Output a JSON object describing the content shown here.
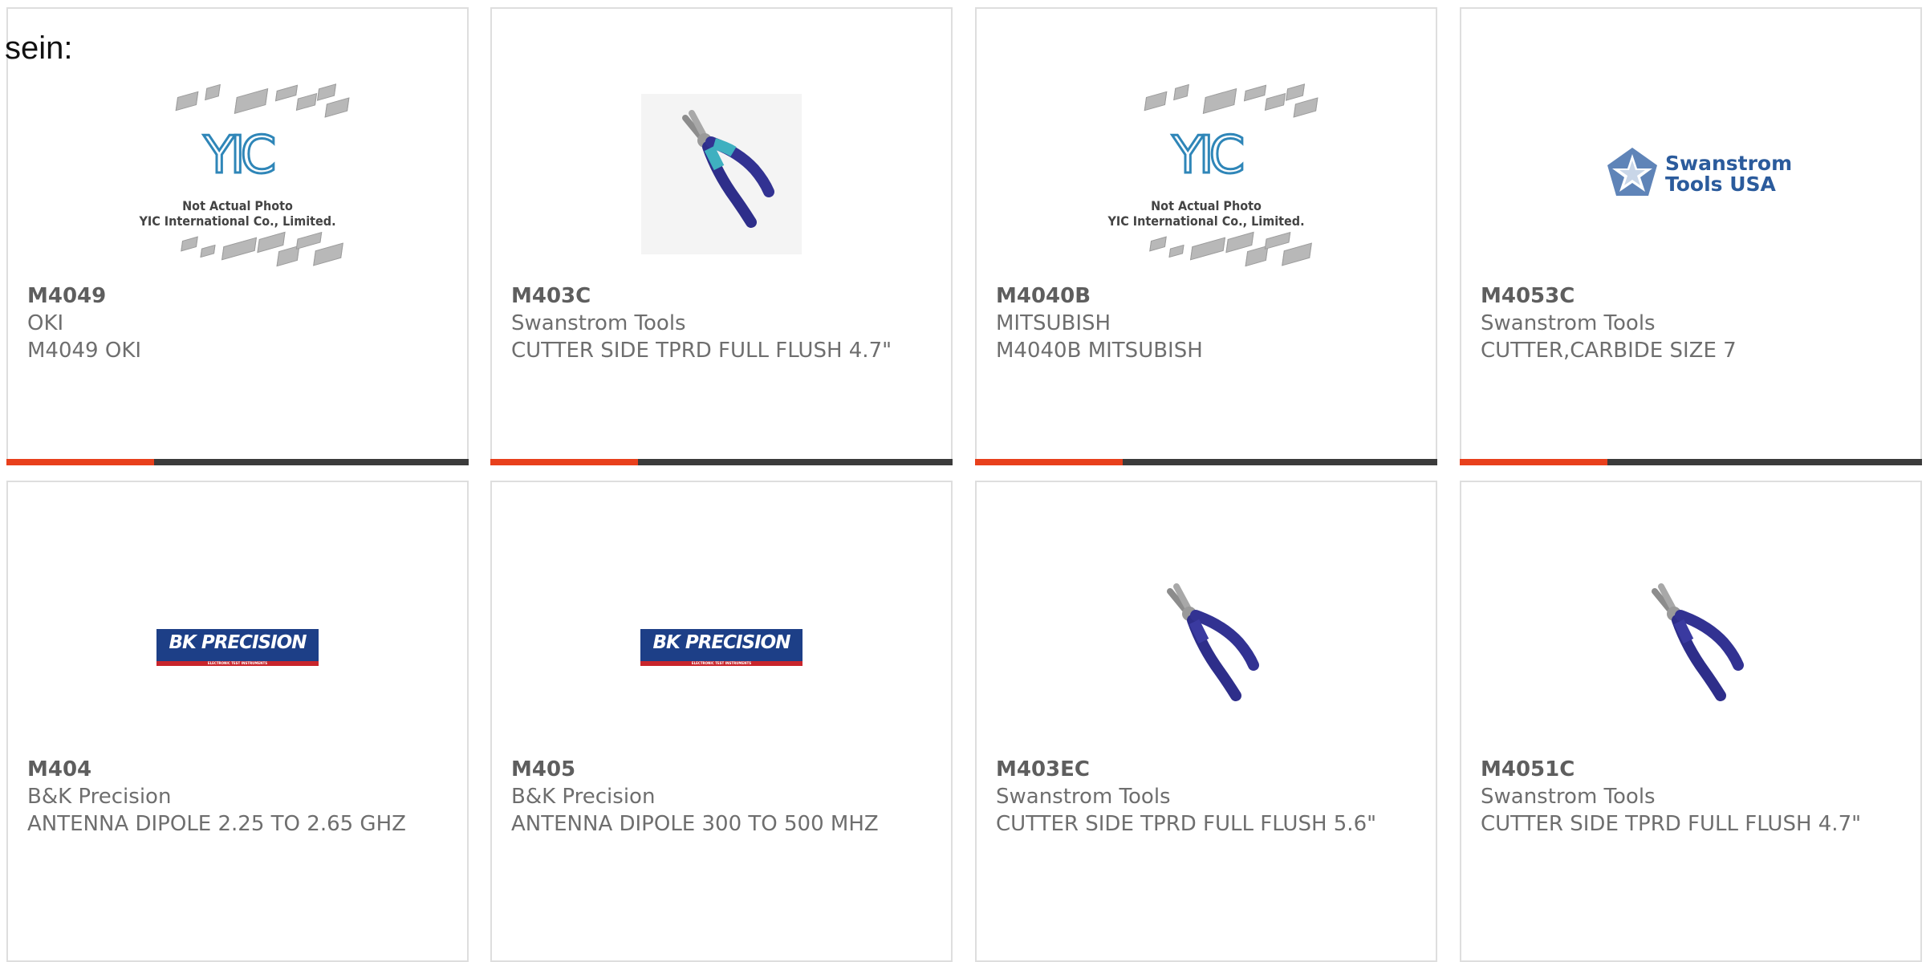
{
  "prefix_text": "sein:",
  "products": [
    {
      "pn": "M4049",
      "mfr": "OKI",
      "desc": "M4049 OKI",
      "image": "yic-placeholder",
      "image_caption": "Not Actual Photo\nYIC International Co., Limited.",
      "image_logo": "YIC"
    },
    {
      "pn": "M403C",
      "mfr": "Swanstrom Tools",
      "desc": "CUTTER SIDE TPRD FULL FLUSH 4.7\"",
      "image": "pliers-photo"
    },
    {
      "pn": "M4040B",
      "mfr": "MITSUBISH",
      "desc": "M4040B MITSUBISH",
      "image": "yic-placeholder",
      "image_caption": "Not Actual Photo\nYIC International Co., Limited.",
      "image_logo": "YIC"
    },
    {
      "pn": "M4053C",
      "mfr": "Swanstrom Tools",
      "desc": "CUTTER,CARBIDE SIZE 7",
      "image": "swanstrom-logo",
      "image_logo": "Swanstrom Tools USA"
    },
    {
      "pn": "M404",
      "mfr": "B&K Precision",
      "desc": "ANTENNA DIPOLE 2.25 TO 2.65 GHZ",
      "image": "bk-precision-logo",
      "image_logo": "BK PRECISION",
      "image_sub": "ELECTRONIC TEST INSTRUMENTS"
    },
    {
      "pn": "M405",
      "mfr": "B&K Precision",
      "desc": "ANTENNA DIPOLE 300 TO 500 MHZ",
      "image": "bk-precision-logo",
      "image_logo": "BK PRECISION",
      "image_sub": "ELECTRONIC TEST INSTRUMENTS"
    },
    {
      "pn": "M403EC",
      "mfr": "Swanstrom Tools",
      "desc": "CUTTER SIDE TPRD FULL FLUSH 5.6\"",
      "image": "pliers-photo"
    },
    {
      "pn": "M4051C",
      "mfr": "Swanstrom Tools",
      "desc": "CUTTER SIDE TPRD FULL FLUSH 4.7\"",
      "image": "pliers-photo"
    }
  ],
  "colors": {
    "accent_bar": "#e8401c",
    "dark_bar": "#3b3b3b",
    "text": "#6e6e6e",
    "card_border": "#dedede"
  }
}
